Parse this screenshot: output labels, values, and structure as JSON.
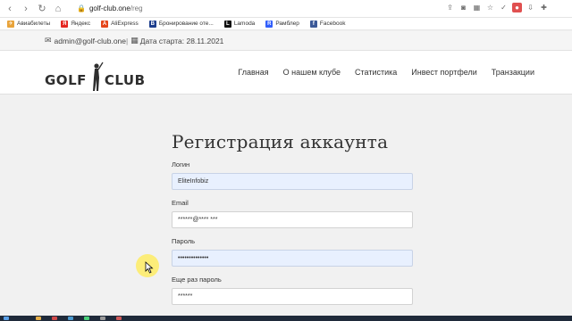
{
  "browser": {
    "url_host": "golf-club.one",
    "url_path": "/reg"
  },
  "bookmarks": [
    {
      "label": "Авиабилеты",
      "icon": "plane-icon",
      "color": "#e8a33a"
    },
    {
      "label": "Яндекс",
      "icon": "yandex-icon",
      "color": "#e52620"
    },
    {
      "label": "AliExpress",
      "icon": "aliexpress-icon",
      "color": "#e5451a"
    },
    {
      "label": "Бронирование оте...",
      "icon": "booking-icon",
      "color": "#1c3d8c"
    },
    {
      "label": "Lamoda",
      "icon": "lamoda-icon",
      "color": "#111111"
    },
    {
      "label": "Рамблер",
      "icon": "rambler-icon",
      "color": "#315efb"
    },
    {
      "label": "Facebook",
      "icon": "facebook-icon",
      "color": "#3b5998"
    }
  ],
  "infobar": {
    "email": "admin@golf-club.one",
    "start_label": "Дата старта: 28.11.2021"
  },
  "logo": {
    "left": "GOLF",
    "right": "CLUB"
  },
  "menu": [
    "Главная",
    "О нашем клубе",
    "Статистика",
    "Инвест портфели",
    "Транзакции"
  ],
  "form": {
    "title": "Регистрация аккаунта",
    "login_label": "Логин",
    "login_value": "EliteInfobiz",
    "email_label": "Email",
    "email_value": "******@**** ***",
    "password_label": "Пароль",
    "password_value": "••••••••••••••",
    "password2_label": "Еще раз пароль",
    "password2_value": "******"
  },
  "colors": {
    "accent_field": "#e8f0fe",
    "page_bg": "#f1f1f1",
    "text": "#333333"
  }
}
